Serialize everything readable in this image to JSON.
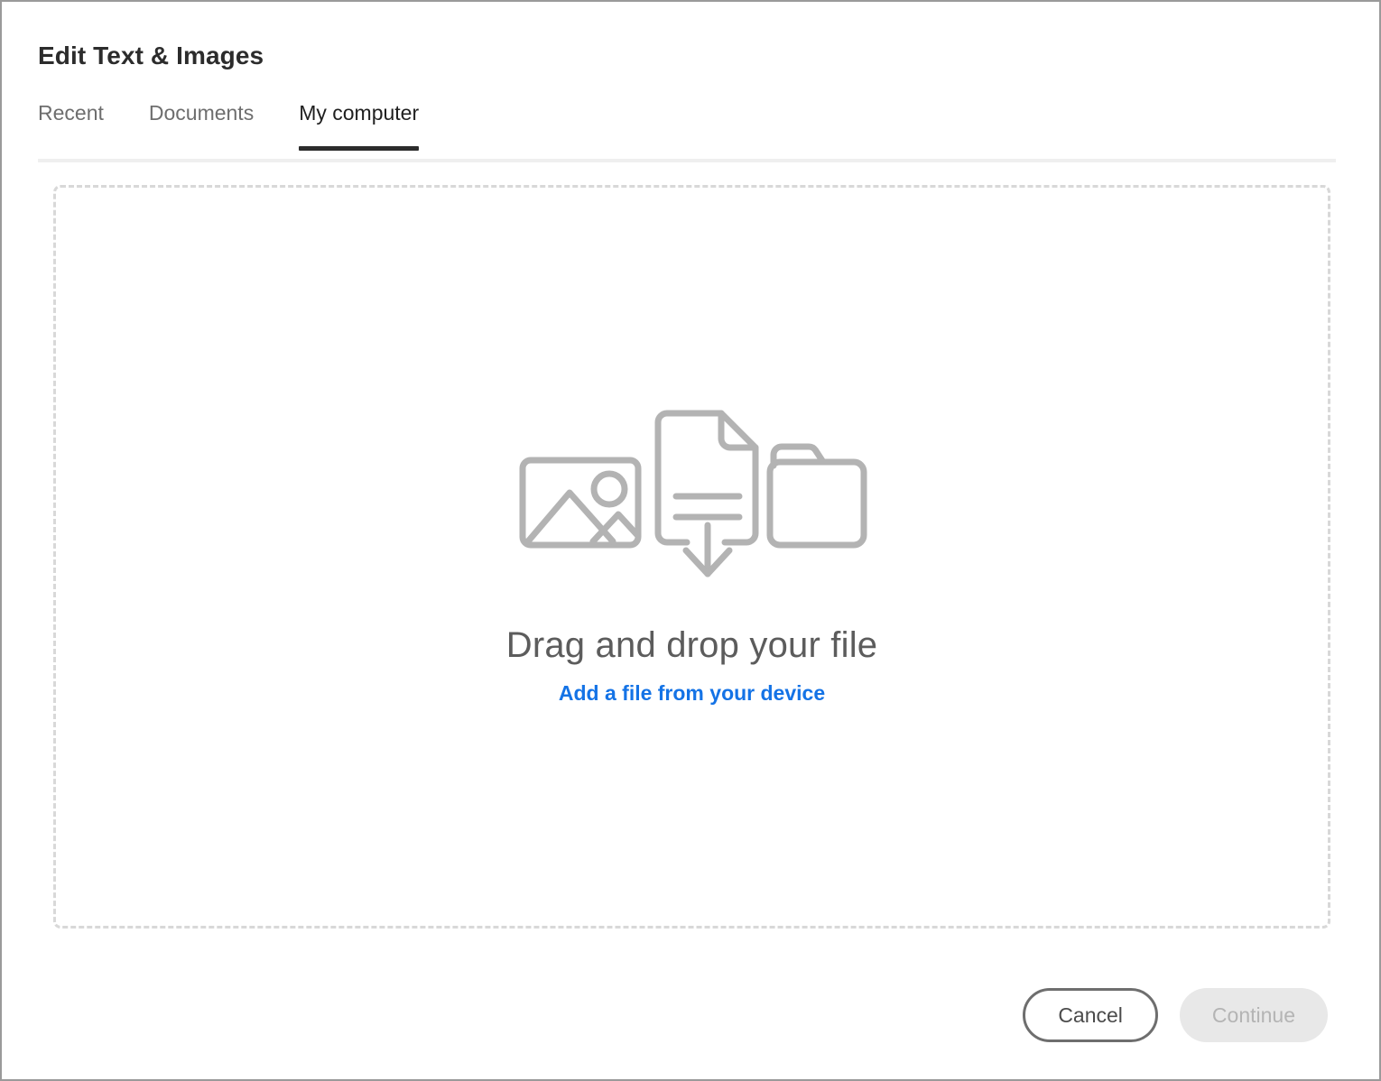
{
  "dialog": {
    "title": "Edit Text & Images"
  },
  "tabs": [
    {
      "label": "Recent",
      "active": false
    },
    {
      "label": "Documents",
      "active": false
    },
    {
      "label": "My computer",
      "active": true
    }
  ],
  "dropzone": {
    "headline": "Drag and drop your file",
    "link_label": "Add a file from your device",
    "icons": [
      "image-icon",
      "document-download-icon",
      "folder-icon"
    ],
    "icon_color": "#b3b3b3",
    "border_color": "#d8d8d8"
  },
  "footer": {
    "cancel_label": "Cancel",
    "continue_label": "Continue"
  },
  "colors": {
    "accent_blue": "#1473e6",
    "title_text": "#2c2c2c",
    "tab_inactive": "#6e6e6e",
    "tab_active": "#1f1f1f",
    "headline_text": "#5c5c5c",
    "continue_bg": "#e8e8e8",
    "continue_text": "#b4b4b4"
  }
}
